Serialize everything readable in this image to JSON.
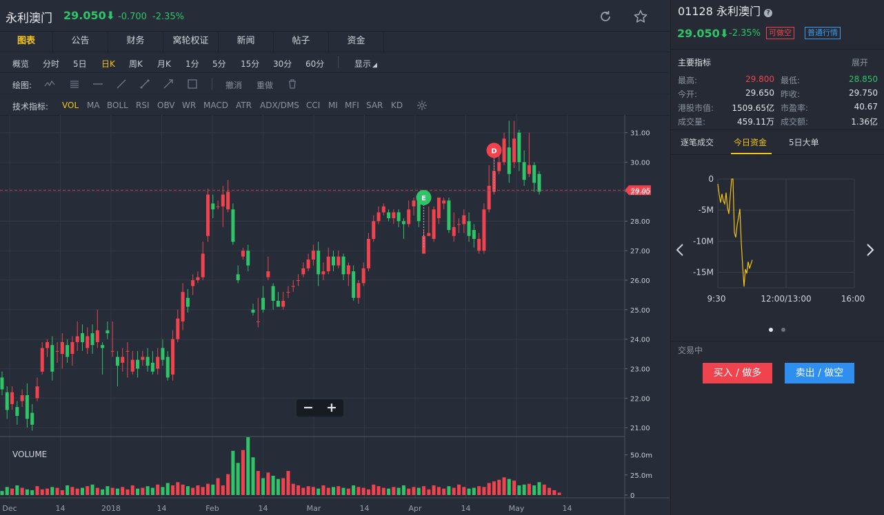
{
  "header": {
    "name": "永利澳门",
    "price": "29.050⬇",
    "change": "-0.700",
    "pct": "-2.35%"
  },
  "tabs": [
    {
      "label": "图表",
      "active": true
    },
    {
      "label": "公告"
    },
    {
      "label": "财务"
    },
    {
      "label": "窝轮权证"
    },
    {
      "label": "新闻"
    },
    {
      "label": "帖子"
    },
    {
      "label": "资金"
    }
  ],
  "periods": [
    {
      "label": "概览"
    },
    {
      "label": "分时"
    },
    {
      "label": "5日"
    },
    {
      "label": "日K",
      "active": true
    },
    {
      "label": "周K"
    },
    {
      "label": "月K"
    },
    {
      "label": "1分"
    },
    {
      "label": "5分"
    },
    {
      "label": "15分"
    },
    {
      "label": "30分"
    },
    {
      "label": "60分"
    }
  ],
  "display_label": "显示",
  "drawing": {
    "label": "绘图:",
    "undo": "撤消",
    "redo": "重做"
  },
  "indicators_label": "技术指标:",
  "indicators": [
    {
      "label": "VOL",
      "active": true
    },
    {
      "label": "MA"
    },
    {
      "label": "BOLL"
    },
    {
      "label": "RSI"
    },
    {
      "label": "OBV"
    },
    {
      "label": "WR"
    },
    {
      "label": "MACD"
    },
    {
      "label": "ATR"
    },
    {
      "label": "ADX/DMS"
    },
    {
      "label": "CCI"
    },
    {
      "label": "MI"
    },
    {
      "label": "MFI"
    },
    {
      "label": "SAR"
    },
    {
      "label": "KD"
    }
  ],
  "chart_data": [
    {
      "type": "candlestick",
      "current_price": 29.05,
      "current_price_label": "29.05",
      "price_axis": [
        "31.00",
        "30.00",
        "29.00",
        "28.00",
        "27.00",
        "26.00",
        "25.00",
        "24.00",
        "23.00",
        "22.00",
        "21.00"
      ],
      "ylim": [
        20.7,
        31.6
      ],
      "x_labels": [
        "Dec",
        "14",
        "2018",
        "14",
        "Feb",
        "14",
        "Mar",
        "14",
        "Apr",
        "14",
        "May",
        "14"
      ],
      "markers": [
        {
          "label": "D",
          "color": "#f0434d"
        },
        {
          "label": "E",
          "color": "#2fc468"
        }
      ],
      "candles": [
        [
          22.7,
          22.3,
          22.9,
          22.1
        ],
        [
          22.2,
          21.6,
          22.4,
          21.3
        ],
        [
          21.8,
          22.2,
          22.4,
          21.6
        ],
        [
          21.7,
          21.4,
          21.9,
          21.1
        ],
        [
          21.9,
          22.1,
          22.3,
          21.7
        ],
        [
          22.1,
          21.3,
          22.5,
          21.0
        ],
        [
          21.5,
          21.1,
          21.8,
          20.9
        ],
        [
          22.0,
          22.4,
          22.7,
          21.9
        ],
        [
          22.9,
          23.7,
          23.9,
          22.8
        ],
        [
          23.7,
          23.9,
          24.0,
          23.4
        ],
        [
          23.8,
          22.9,
          24.1,
          22.6
        ],
        [
          23.6,
          23.6,
          23.9,
          23.2
        ],
        [
          23.5,
          23.9,
          24.2,
          23.0
        ],
        [
          23.8,
          23.4,
          24.0,
          23.2
        ],
        [
          23.5,
          23.9,
          24.1,
          23.1
        ],
        [
          23.9,
          24.1,
          24.6,
          23.6
        ],
        [
          24.2,
          23.9,
          24.5,
          23.6
        ],
        [
          23.7,
          24.1,
          24.4,
          23.5
        ],
        [
          24.2,
          23.8,
          24.5,
          23.5
        ],
        [
          23.9,
          24.3,
          25.0,
          23.7
        ],
        [
          23.8,
          23.7,
          23.9,
          22.8
        ],
        [
          24.3,
          24.2,
          24.6,
          24.0
        ],
        [
          23.6,
          23.6,
          24.6,
          23.4
        ],
        [
          23.4,
          23.1,
          23.6,
          22.4
        ],
        [
          23.2,
          23.4,
          23.7,
          22.9
        ],
        [
          23.6,
          23.6,
          23.9,
          22.7
        ],
        [
          22.9,
          23.3,
          23.6,
          22.8
        ],
        [
          23.3,
          23.0,
          23.6,
          22.7
        ],
        [
          23.3,
          23.4,
          23.6,
          23.1
        ],
        [
          23.4,
          23.1,
          23.7,
          22.9
        ],
        [
          23.2,
          22.9,
          23.6,
          22.8
        ],
        [
          23.0,
          23.4,
          23.7,
          22.8
        ],
        [
          23.7,
          23.3,
          24.0,
          23.1
        ],
        [
          23.4,
          22.7,
          23.6,
          22.6
        ],
        [
          22.8,
          24.0,
          24.3,
          22.6
        ],
        [
          24.0,
          24.7,
          25.0,
          23.9
        ],
        [
          24.6,
          25.6,
          25.9,
          24.3
        ],
        [
          25.4,
          25.1,
          25.7,
          24.9
        ],
        [
          25.8,
          26.0,
          26.2,
          25.5
        ],
        [
          26.0,
          26.1,
          26.3,
          25.9
        ],
        [
          26.1,
          26.9,
          27.3,
          26.0
        ],
        [
          27.5,
          28.9,
          29.1,
          27.3
        ],
        [
          28.6,
          28.4,
          28.9,
          28.1
        ],
        [
          28.5,
          28.5,
          28.7,
          28.4
        ],
        [
          28.5,
          28.9,
          29.2,
          27.8
        ],
        [
          28.4,
          29.0,
          29.4,
          28.3
        ],
        [
          28.4,
          27.3,
          28.6,
          27.2
        ],
        [
          26.2,
          26.0,
          26.5,
          25.9
        ],
        [
          26.8,
          27.0,
          27.1,
          26.7
        ],
        [
          27.0,
          26.5,
          27.2,
          26.3
        ],
        [
          25.0,
          24.9,
          25.2,
          24.8
        ],
        [
          24.6,
          24.6,
          25.4,
          24.4
        ],
        [
          25.4,
          25.0,
          25.8,
          24.9
        ],
        [
          26.1,
          26.3,
          26.8,
          26.0
        ],
        [
          25.8,
          25.3,
          25.9,
          25.0
        ],
        [
          25.3,
          25.1,
          25.6,
          25.1
        ],
        [
          25.1,
          25.3,
          25.6,
          25.0
        ],
        [
          25.6,
          25.6,
          25.8,
          25.4
        ],
        [
          25.8,
          25.8,
          26.0,
          25.6
        ],
        [
          26.0,
          26.0,
          26.2,
          25.8
        ],
        [
          26.2,
          26.4,
          26.6,
          26.1
        ],
        [
          26.4,
          26.7,
          26.9,
          26.3
        ],
        [
          26.7,
          27.0,
          27.2,
          26.5
        ],
        [
          27.0,
          26.2,
          27.3,
          25.8
        ],
        [
          26.2,
          26.3,
          26.6,
          26.0
        ],
        [
          26.3,
          26.8,
          27.1,
          26.2
        ],
        [
          26.8,
          26.5,
          27.0,
          26.3
        ],
        [
          26.5,
          26.8,
          27.0,
          26.4
        ],
        [
          26.8,
          26.2,
          26.9,
          26.0
        ],
        [
          26.2,
          26.5,
          26.6,
          25.8
        ],
        [
          26.3,
          25.4,
          26.5,
          25.3
        ],
        [
          25.4,
          25.9,
          26.0,
          25.2
        ],
        [
          25.9,
          26.4,
          26.6,
          25.8
        ],
        [
          26.4,
          27.4,
          27.6,
          26.3
        ],
        [
          27.4,
          28.0,
          28.2,
          27.3
        ],
        [
          28.0,
          28.3,
          28.5,
          27.9
        ],
        [
          28.3,
          28.5,
          28.6,
          28.2
        ],
        [
          28.3,
          28.1,
          28.4,
          28.0
        ],
        [
          28.1,
          28.3,
          28.4,
          27.9
        ],
        [
          28.3,
          28.0,
          28.4,
          27.8
        ],
        [
          28.0,
          27.9,
          28.1,
          27.4
        ],
        [
          27.9,
          28.4,
          28.7,
          27.8
        ],
        [
          28.5,
          28.7,
          28.8,
          28.2
        ],
        [
          28.7,
          28.0,
          28.9,
          27.8
        ],
        [
          26.9,
          27.5,
          27.7,
          26.9
        ],
        [
          27.5,
          27.6,
          28.5,
          27.5
        ],
        [
          27.4,
          28.4,
          28.5,
          27.3
        ],
        [
          28.1,
          28.8,
          28.8,
          27.9
        ],
        [
          28.6,
          28.7,
          28.8,
          28.4
        ],
        [
          28.7,
          27.7,
          28.8,
          27.6
        ],
        [
          27.5,
          27.8,
          28.3,
          27.3
        ],
        [
          27.9,
          27.9,
          28.1,
          27.6
        ],
        [
          27.9,
          28.2,
          28.4,
          27.6
        ],
        [
          28.0,
          27.5,
          28.3,
          27.3
        ],
        [
          27.7,
          27.4,
          27.9,
          27.1
        ],
        [
          27.0,
          27.4,
          27.6,
          26.9
        ],
        [
          27.0,
          28.4,
          28.6,
          26.9
        ],
        [
          28.4,
          29.2,
          29.9,
          28.3
        ],
        [
          29.0,
          29.7,
          30.3,
          28.9
        ],
        [
          29.7,
          30.0,
          30.5,
          29.6
        ],
        [
          30.0,
          30.8,
          31.0,
          29.9
        ],
        [
          30.5,
          29.6,
          31.4,
          29.3
        ],
        [
          30.0,
          30.8,
          31.4,
          29.8
        ],
        [
          31.0,
          30.0,
          31.1,
          29.7
        ],
        [
          30.0,
          29.4,
          30.4,
          29.2
        ],
        [
          29.6,
          29.9,
          31.0,
          29.5
        ],
        [
          29.9,
          29.3,
          30.0,
          29.0
        ],
        [
          29.6,
          29.0,
          29.7,
          28.9
        ]
      ],
      "bar_colors": [
        "#f0434d",
        "#2fc468"
      ]
    },
    {
      "type": "bar",
      "title": "VOLUME",
      "axis": [
        "50.0m",
        "25.0m",
        "0"
      ],
      "ylim": [
        0,
        72
      ],
      "values": [
        5,
        10,
        8,
        12,
        9,
        7,
        6,
        11,
        7,
        8,
        10,
        9,
        6,
        12,
        10,
        8,
        9,
        11,
        13,
        9,
        7,
        11,
        9,
        8,
        10,
        7,
        12,
        8,
        9,
        11,
        9,
        13,
        10,
        15,
        12,
        16,
        13,
        11,
        9,
        12,
        10,
        14,
        13,
        21,
        12,
        26,
        55,
        40,
        56,
        72,
        47,
        30,
        21,
        28,
        24,
        20,
        21,
        30,
        14,
        12,
        9,
        11,
        10,
        8,
        12,
        9,
        10,
        11,
        9,
        8,
        12,
        10,
        9,
        7,
        13,
        11,
        9,
        8,
        10,
        9,
        12,
        8,
        10,
        9,
        11,
        7,
        12,
        10,
        8,
        11,
        9,
        13,
        10,
        8,
        9,
        11,
        10,
        15,
        17,
        19,
        22,
        20,
        18,
        12,
        13,
        14,
        12,
        16,
        13,
        9,
        6,
        3
      ]
    }
  ],
  "right": {
    "code_name": "01128 永利澳门",
    "price": "29.050⬇",
    "pct": "-2.35%",
    "badge_short": "可做空",
    "badge_quote": "普通行情",
    "section": "主要指标",
    "expand": "展开",
    "stats": [
      {
        "label": "最高:",
        "value": "29.800",
        "color": "#f0434d"
      },
      {
        "label": "最低:",
        "value": "28.850",
        "color": "#2fc468"
      },
      {
        "label": "今开:",
        "value": "29.650"
      },
      {
        "label": "昨收:",
        "value": "29.750"
      },
      {
        "label": "港股市值:",
        "value": "1509.65亿"
      },
      {
        "label": "市盈率:",
        "value": "40.67"
      },
      {
        "label": "成交量:",
        "value": "459.11万"
      },
      {
        "label": "成交额:",
        "value": "1.36亿"
      }
    ],
    "tabs": [
      {
        "label": "逐笔成交"
      },
      {
        "label": "今日资金",
        "active": true
      },
      {
        "label": "5日大单"
      }
    ],
    "flow_chart": {
      "type": "line",
      "y_axis": [
        "0",
        "-5M",
        "-10M",
        "-15M"
      ],
      "x_axis": [
        "9:30",
        "12:00/13:00",
        "16:00"
      ],
      "ylim": [
        -17.5,
        0
      ],
      "values": [
        -0.8,
        -2.5,
        -3.8,
        -2.4,
        -3.5,
        -4.0,
        -2.2,
        -4.6,
        -5.6,
        -2.8,
        0,
        0,
        -8.6,
        -9.4,
        -7.4,
        -6.2,
        -4.8,
        -10.2,
        -14.0,
        -17.3,
        -14.5,
        -15.2,
        -13.3,
        -14.4,
        -13.7,
        -13.0
      ]
    },
    "trading_status": "交易中",
    "buy_label": "买入 / 做多",
    "sell_label": "卖出 / 做空"
  }
}
